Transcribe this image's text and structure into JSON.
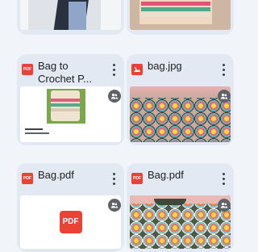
{
  "cards": [
    {
      "title": "Bag to Crochet P...",
      "badge": "PDF",
      "type": "pdf"
    },
    {
      "title": "bag.jpg",
      "badge": "",
      "type": "image"
    },
    {
      "title": "Bag.pdf",
      "badge": "PDF",
      "type": "pdf"
    },
    {
      "title": "Bag.pdf",
      "badge": "PDF",
      "type": "pdf"
    }
  ],
  "pdf_tile_label": "PDF",
  "icons": {
    "more": "more-vert-icon",
    "shared": "shared-people-icon",
    "pdf": "pdf-file-icon",
    "image": "image-file-icon"
  },
  "colors": {
    "pdf_red": "#ea4335",
    "card_bg": "#e3e9f2",
    "page_bg": "#f1f4f9"
  }
}
